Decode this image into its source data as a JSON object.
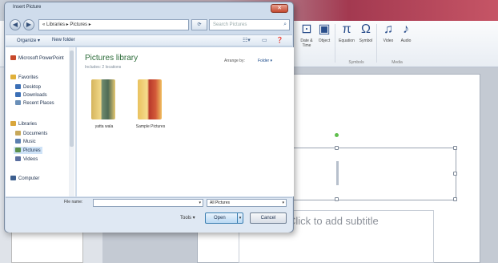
{
  "dialog": {
    "title": "Insert Picture",
    "close_glyph": "✕",
    "address": "« Libraries ▸ Pictures ▸",
    "search_placeholder": "Search Pictures",
    "toolbar": {
      "organize": "Organize ▾",
      "new_folder": "New folder"
    },
    "nav_pane": {
      "items": [
        {
          "label": "Microsoft PowerPoint",
          "icon": "powerpoint-icon",
          "color": "#c8492b"
        },
        {
          "label": "Favorites",
          "icon": "star-icon",
          "color": "#e0b03a"
        },
        {
          "label": "Desktop",
          "icon": "desktop-icon",
          "color": "#3b6fb6"
        },
        {
          "label": "Downloads",
          "icon": "downloads-icon",
          "color": "#3b6fb6"
        },
        {
          "label": "Recent Places",
          "icon": "recent-icon",
          "color": "#6a8fb8"
        },
        {
          "label": "Libraries",
          "icon": "libraries-icon",
          "color": "#d9a63c"
        },
        {
          "label": "Documents",
          "icon": "documents-icon",
          "color": "#c7a85a"
        },
        {
          "label": "Music",
          "icon": "music-icon",
          "color": "#5b7fb0"
        },
        {
          "label": "Pictures",
          "icon": "pictures-icon",
          "color": "#5a8f4c"
        },
        {
          "label": "Videos",
          "icon": "videos-icon",
          "color": "#5b6fa0"
        },
        {
          "label": "Computer",
          "icon": "computer-icon",
          "color": "#3d5f8f"
        }
      ]
    },
    "library": {
      "title": "Pictures library",
      "subtitle": "Includes: 2 locations",
      "arrange_label": "Arrange by:",
      "arrange_value": "Folder ▾"
    },
    "folders": [
      {
        "name": "yatta wala"
      },
      {
        "name": "Sample Pictures"
      }
    ],
    "file_name_label": "File name:",
    "file_name_value": "",
    "filter_value": "All Pictures",
    "tools_label": "Tools ▾",
    "open_label": "Open",
    "cancel_label": "Cancel"
  },
  "ribbon": {
    "buttons": [
      {
        "glyph": "⊡",
        "label": "Date & Time",
        "icon": "date-time-icon"
      },
      {
        "glyph": "▣",
        "label": "Object",
        "icon": "object-icon"
      },
      {
        "glyph": "π",
        "label": "Equation",
        "icon": "equation-icon"
      },
      {
        "glyph": "Ω",
        "label": "Symbol",
        "icon": "symbol-icon"
      },
      {
        "glyph": "♫",
        "label": "Video",
        "icon": "video-icon"
      },
      {
        "glyph": "♪",
        "label": "Audio",
        "icon": "audio-icon"
      }
    ],
    "groups": [
      "Symbols",
      "Media"
    ]
  },
  "slide": {
    "subtitle_placeholder": "Click to add subtitle"
  }
}
